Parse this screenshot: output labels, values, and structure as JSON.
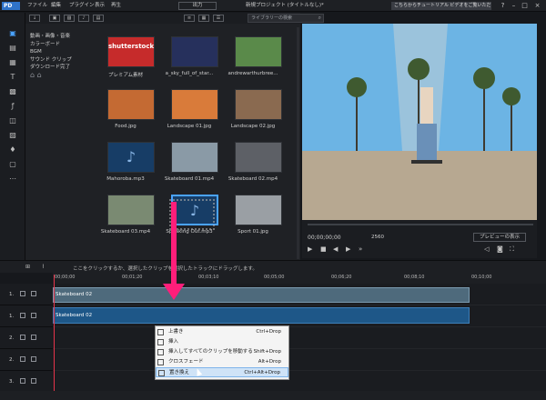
{
  "titlebar": {
    "menu": [
      "ファイル",
      "編集",
      "プラグイン",
      "表示",
      "再生"
    ],
    "export_label": "出力",
    "project_title": "新規プロジェクト (タイトルなし)*",
    "tutorial_banner": "こちらからチュートリアル ビデオをご覧いただけます。"
  },
  "library": {
    "search_placeholder": "ライブラリーの検索",
    "categories": [
      "動画・画像・音楽",
      "カラーボード",
      "BGM",
      "サウンド クリップ",
      "ダウンロード完了"
    ],
    "items": [
      {
        "label": "プレミアム素材",
        "thumb": "#c62b2b",
        "text": "shutterstock"
      },
      {
        "label": "a_sky_full_of_star...",
        "thumb": "#26305c"
      },
      {
        "label": "andrewarthurbree...",
        "thumb": "#5a8a4a"
      },
      {
        "label": "Food.jpg",
        "thumb": "#c46a33"
      },
      {
        "label": "Landscape 01.jpg",
        "thumb": "#d97b3a"
      },
      {
        "label": "Landscape 02.jpg",
        "thumb": "#8a6a50"
      },
      {
        "label": "Mahoroba.mp3",
        "thumb": "#173d66"
      },
      {
        "label": "Skateboard 01.mp4",
        "thumb": "#8a9aa6"
      },
      {
        "label": "Skateboard 02.mp4",
        "thumb": "#5d6066"
      },
      {
        "label": "Skateboard 03.mp4",
        "thumb": "#7a8a72"
      },
      {
        "label": "Speaking Out.mp3",
        "thumb": "#173d66"
      },
      {
        "label": "Sport 01.jpg",
        "thumb": "#9a9fa4"
      }
    ]
  },
  "preview": {
    "timecode": "00;00;00;00",
    "quality": "2560",
    "preview_button": "プレビューの表示"
  },
  "timeline": {
    "hint": "ここをクリックするか、選択したクリップを選択したトラックにドラッグします。",
    "ruler": [
      "00;00;00",
      "00;01;20",
      "00;03;10",
      "00;05;00",
      "00;06;20",
      "00;08;10",
      "00;10;00"
    ],
    "tracks": [
      "1.",
      "1.",
      "2.",
      "2.",
      "3.",
      "3."
    ],
    "video_clip": "Skateboard 02",
    "audio_clip": "Skateboard 02"
  },
  "context_menu": {
    "items": [
      {
        "label": "上書き",
        "shortcut": "Ctrl+Drop"
      },
      {
        "label": "挿入",
        "shortcut": ""
      },
      {
        "label": "挿入してすべてのクリップを移動する",
        "shortcut": "Shift+Drop"
      },
      {
        "label": "クロスフェード",
        "shortcut": "Alt+Drop"
      },
      {
        "label": "置き換え",
        "shortcut": "Ctrl+Alt+Drop"
      }
    ]
  },
  "colors": {
    "accent": "#4aa3ff",
    "drag_arrow": "#ff1e7a",
    "playhead": "#e5344a"
  }
}
